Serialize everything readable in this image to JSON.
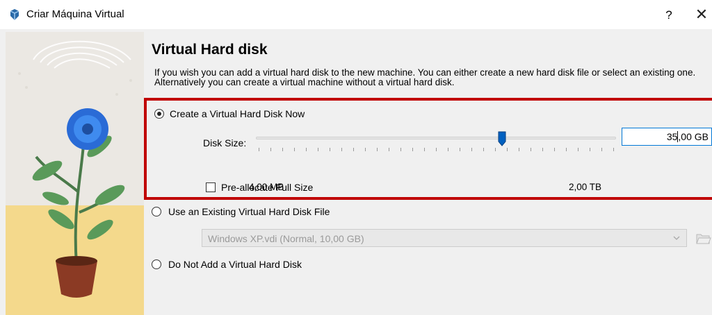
{
  "window": {
    "title": "Criar Máquina Virtual",
    "help_label": "?",
    "close_label": "✕"
  },
  "page": {
    "heading": "Virtual Hard disk",
    "description": "If you wish you can add a virtual hard disk to the new machine. You can either create a new hard disk file or select an existing one. Alternatively you can create a virtual machine without a virtual hard disk."
  },
  "options": {
    "create_now": {
      "label": "Create a Virtual Hard Disk Now",
      "selected": true
    },
    "use_existing": {
      "label": "Use an Existing Virtual Hard Disk File",
      "selected": false
    },
    "do_not_add": {
      "label": "Do Not Add a Virtual Hard Disk",
      "selected": false
    }
  },
  "disk_size": {
    "label": "Disk Size:",
    "value_before_caret": "35",
    "value_after_caret": ",00 GB",
    "min_label": "4,00 MB",
    "max_label": "2,00 TB",
    "slider_fraction": 0.683
  },
  "preallocate": {
    "label": "Pre-allocate Full Size",
    "checked": false
  },
  "existing_file": {
    "selected_value": "Windows XP.vdi (Normal, 10,00 GB)",
    "enabled": false
  },
  "colors": {
    "highlight": "#c00000",
    "slider_handle": "#0060c0",
    "input_border": "#0078d7"
  }
}
